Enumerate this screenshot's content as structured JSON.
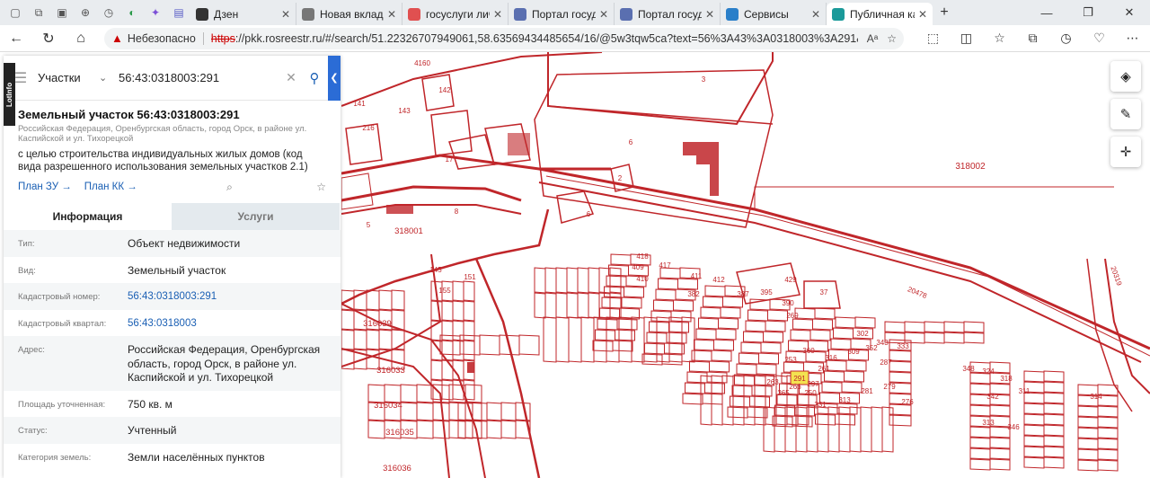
{
  "browser": {
    "tabs": [
      {
        "title": "Дзен",
        "color": "#333333"
      },
      {
        "title": "Новая вкладка",
        "color": "#777777"
      },
      {
        "title": "госуслуги личн",
        "color": "#e05050"
      },
      {
        "title": "Портал госуда",
        "color": "#5a6fb0"
      },
      {
        "title": "Портал госуда",
        "color": "#5a6fb0"
      },
      {
        "title": "Сервисы",
        "color": "#2a7fc9"
      },
      {
        "title": "Публичная кадас",
        "color": "#1a9a9a"
      }
    ],
    "insecure_label": "Небезопасно",
    "url_scheme": "https",
    "url_rest": "://pkk.rosreestr.ru/#/search/51.22326707949061,58.63569434485654/16/@5w3tqw5ca?text=56%3A43%3A0318003%3A291&ty..."
  },
  "panel": {
    "search_type": "Участки",
    "search_value": "56:43:0318003:291",
    "lotinfo": "LotInfo",
    "title": "Земельный участок 56:43:0318003:291",
    "address_small": "Российская Федерация, Оренбургская область, город Орск, в районе ул. Каспийской и ул. Тихорецкой",
    "usage": "с целью строительства индивидуальных жилых домов (код вида разрешенного использования земельных участков 2.1)",
    "link_plan_zu": "План ЗУ →",
    "link_plan_kk": "План КК →",
    "tab_info": "Информация",
    "tab_services": "Услуги",
    "rows": [
      {
        "key": "Тип:",
        "value": "Объект недвижимости"
      },
      {
        "key": "Вид:",
        "value": "Земельный участок"
      },
      {
        "key": "Кадастровый номер:",
        "value": "56:43:0318003:291"
      },
      {
        "key": "Кадастровый квартал:",
        "value": "56:43:0318003"
      },
      {
        "key": "Адрес:",
        "value": "Российская Федерация, Оренбургская область, город Орск, в районе ул. Каспийской и ул. Тихорецкой"
      },
      {
        "key": "Площадь уточненная:",
        "value": "750 кв. м"
      },
      {
        "key": "Статус:",
        "value": "Учтенный"
      },
      {
        "key": "Категория земель:",
        "value": "Земли населённых пунктов"
      }
    ]
  },
  "map": {
    "quarter_labels": [
      "318002",
      "318001",
      "316039",
      "316033",
      "316035",
      "316036",
      "316034"
    ],
    "selected_parcel": "291",
    "parcel_color": "#c0262a",
    "selected_color": "#f3e250",
    "road_labels": [
      "20478",
      "20319"
    ],
    "plot_numbers": [
      "4160",
      "142",
      "141",
      "143",
      "216",
      "17",
      "6",
      "3",
      "2",
      "6",
      "5",
      "8",
      "145",
      "155",
      "151",
      "429",
      "37",
      "418",
      "417",
      "409",
      "410",
      "411",
      "412",
      "382",
      "387",
      "395",
      "390",
      "269",
      "302",
      "343",
      "333",
      "287",
      "324",
      "318",
      "311",
      "314",
      "342",
      "348",
      "360",
      "316",
      "309",
      "352",
      "253",
      "261",
      "263",
      "265",
      "266",
      "250",
      "331",
      "297",
      "313",
      "281",
      "279",
      "276",
      "313",
      "346"
    ]
  }
}
